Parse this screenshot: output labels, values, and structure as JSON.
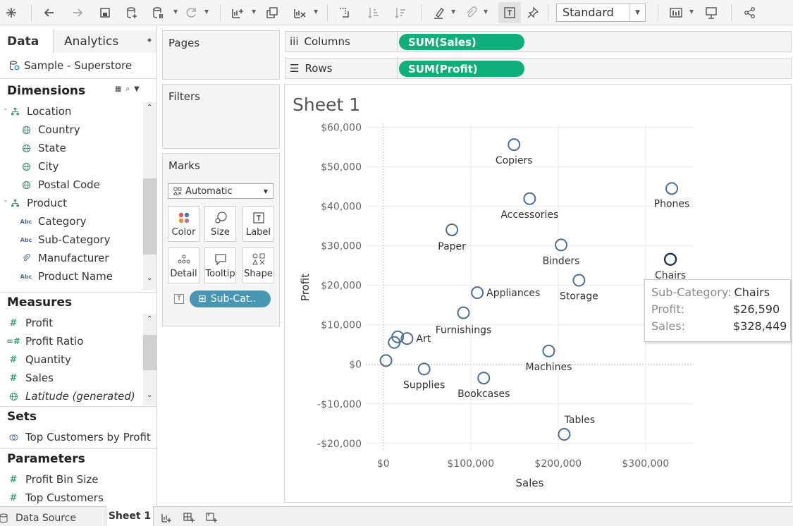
{
  "toolbar": {
    "view_mode": "Standard"
  },
  "data_pane": {
    "tabs": {
      "data": "Data",
      "analytics": "Analytics"
    },
    "datasource": "Sample - Superstore",
    "dimensions": {
      "title": "Dimensions",
      "items": [
        {
          "label": "Location",
          "type": "hierarchy"
        },
        {
          "label": "Country",
          "type": "geo"
        },
        {
          "label": "State",
          "type": "geo"
        },
        {
          "label": "City",
          "type": "geo"
        },
        {
          "label": "Postal Code",
          "type": "geo"
        },
        {
          "label": "Product",
          "type": "hierarchy"
        },
        {
          "label": "Category",
          "type": "string"
        },
        {
          "label": "Sub-Category",
          "type": "string"
        },
        {
          "label": "Manufacturer",
          "type": "group"
        },
        {
          "label": "Product Name",
          "type": "string"
        }
      ]
    },
    "measures": {
      "title": "Measures",
      "items": [
        {
          "label": "Profit",
          "type": "number"
        },
        {
          "label": "Profit Ratio",
          "type": "calc"
        },
        {
          "label": "Quantity",
          "type": "number"
        },
        {
          "label": "Sales",
          "type": "number"
        },
        {
          "label": "Latitude (generated)",
          "type": "geo"
        }
      ]
    },
    "sets": {
      "title": "Sets",
      "items": [
        {
          "label": "Top Customers by Profit"
        }
      ]
    },
    "parameters": {
      "title": "Parameters",
      "items": [
        {
          "label": "Profit Bin Size"
        },
        {
          "label": "Top Customers"
        }
      ]
    }
  },
  "shelves": {
    "pages": "Pages",
    "filters": "Filters",
    "marks": {
      "title": "Marks",
      "type": "Automatic",
      "buttons": {
        "color": "Color",
        "size": "Size",
        "label": "Label",
        "detail": "Detail",
        "tooltip": "Tooltip",
        "shape": "Shape"
      },
      "label_pill": "Sub-Cat.."
    },
    "columns": {
      "label": "Columns",
      "pill": "SUM(Sales)"
    },
    "rows": {
      "label": "Rows",
      "pill": "SUM(Profit)"
    }
  },
  "sheet": {
    "title": "Sheet 1"
  },
  "chart_data": {
    "type": "scatter",
    "xlabel": "Sales",
    "ylabel": "Profit",
    "xlim": [
      -20000,
      355000
    ],
    "ylim": [
      -22000,
      61000
    ],
    "x_ticks": [
      0,
      100000,
      200000,
      300000
    ],
    "x_tick_labels": [
      "$0",
      "$100,000",
      "$200,000",
      "$300,000"
    ],
    "y_ticks": [
      -20000,
      -10000,
      0,
      10000,
      20000,
      30000,
      40000,
      50000,
      60000
    ],
    "y_tick_labels": [
      "-$20,000",
      "-$10,000",
      "$0",
      "$10,000",
      "$20,000",
      "$30,000",
      "$40,000",
      "$50,000",
      "$60,000"
    ],
    "grid": true,
    "color": "#4e6f8e",
    "points": [
      {
        "label": "Copiers",
        "x": 149528,
        "y": 55618
      },
      {
        "label": "Phones",
        "x": 330007,
        "y": 44516
      },
      {
        "label": "Accessories",
        "x": 167380,
        "y": 41937
      },
      {
        "label": "Paper",
        "x": 78479,
        "y": 34054
      },
      {
        "label": "Binders",
        "x": 203413,
        "y": 30222
      },
      {
        "label": "Chairs",
        "x": 328449,
        "y": 26590,
        "highlight": true
      },
      {
        "label": "Storage",
        "x": 223844,
        "y": 21279
      },
      {
        "label": "Appliances",
        "x": 107532,
        "y": 18138
      },
      {
        "label": "Furnishings",
        "x": 91705,
        "y": 13059
      },
      {
        "label": "Art",
        "x": 27119,
        "y": 6528
      },
      {
        "label": "",
        "x": 16476,
        "y": 6964
      },
      {
        "label": "",
        "x": 12486,
        "y": 5546
      },
      {
        "label": "",
        "x": 3024,
        "y": 950
      },
      {
        "label": "Supplies",
        "x": 46674,
        "y": -1189
      },
      {
        "label": "Machines",
        "x": 189239,
        "y": 3385
      },
      {
        "label": "Bookcases",
        "x": 114880,
        "y": -3473
      },
      {
        "label": "Tables",
        "x": 206966,
        "y": -17725
      }
    ]
  },
  "tooltip": {
    "rows": [
      {
        "key": "Sub-Category:",
        "value": "Chairs"
      },
      {
        "key": "Profit:",
        "value": "$26,590"
      },
      {
        "key": "Sales:",
        "value": "$328,449"
      }
    ]
  },
  "bottom_tabs": {
    "data_source": "Data Source",
    "sheet": "Sheet 1"
  }
}
